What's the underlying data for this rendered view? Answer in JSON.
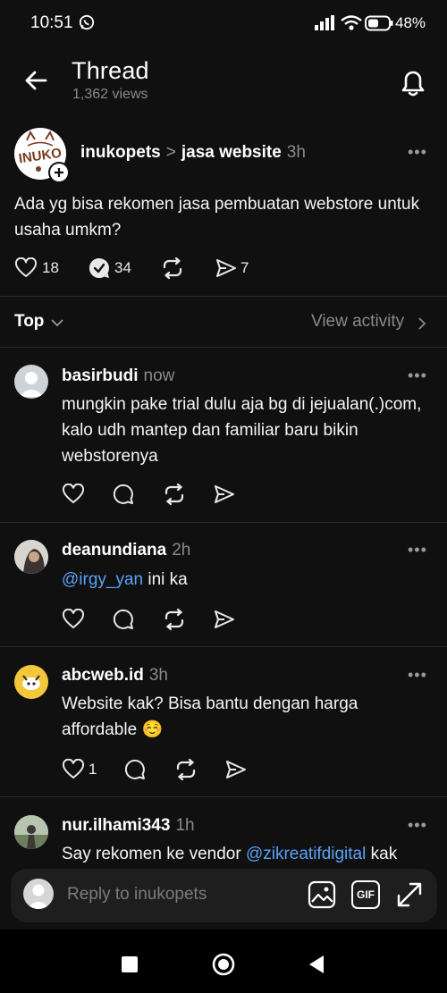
{
  "status_bar": {
    "time": "10:51",
    "battery": "48%"
  },
  "header": {
    "title": "Thread",
    "views": "1,362 views"
  },
  "post": {
    "author": "inukopets",
    "separator": ">",
    "topic": "jasa website",
    "time": "3h",
    "avatar_text": "INUKO",
    "text": "Ada yg bisa rekomen jasa pembuatan webstore untuk usaha umkm?",
    "likes": "18",
    "replies": "34",
    "shares": "7"
  },
  "sort": {
    "label": "Top",
    "view_activity": "View activity"
  },
  "replies": [
    {
      "author": "basirbudi",
      "time": "now",
      "text": "mungkin pake trial dulu aja bg di jejualan(.)com, kalo udh mantep dan familiar baru bikin webstorenya",
      "likes": ""
    },
    {
      "author": "deanundiana",
      "time": "2h",
      "mention": "@irgy_yan",
      "text": " ini ka",
      "likes": ""
    },
    {
      "author": "abcweb.id",
      "time": "3h",
      "text": "Website kak? Bisa bantu dengan harga affordable ☺️",
      "likes": "1"
    },
    {
      "author": "nur.ilhami343",
      "time": "1h",
      "text_before": "Say rekomen ke vendor ",
      "mention": "@zikreatifdigital",
      "text_after": " kak"
    }
  ],
  "reply_bar": {
    "placeholder": "Reply to inukopets",
    "gif_label": "GIF"
  },
  "icons": [
    "back-arrow-icon",
    "bell-icon",
    "heart-icon",
    "reply-icon",
    "repost-icon",
    "send-icon",
    "image-icon",
    "gif-icon",
    "expand-icon"
  ],
  "colors": {
    "background": "#101010",
    "mention": "#5aa2f5",
    "muted": "#8a8a8a"
  }
}
